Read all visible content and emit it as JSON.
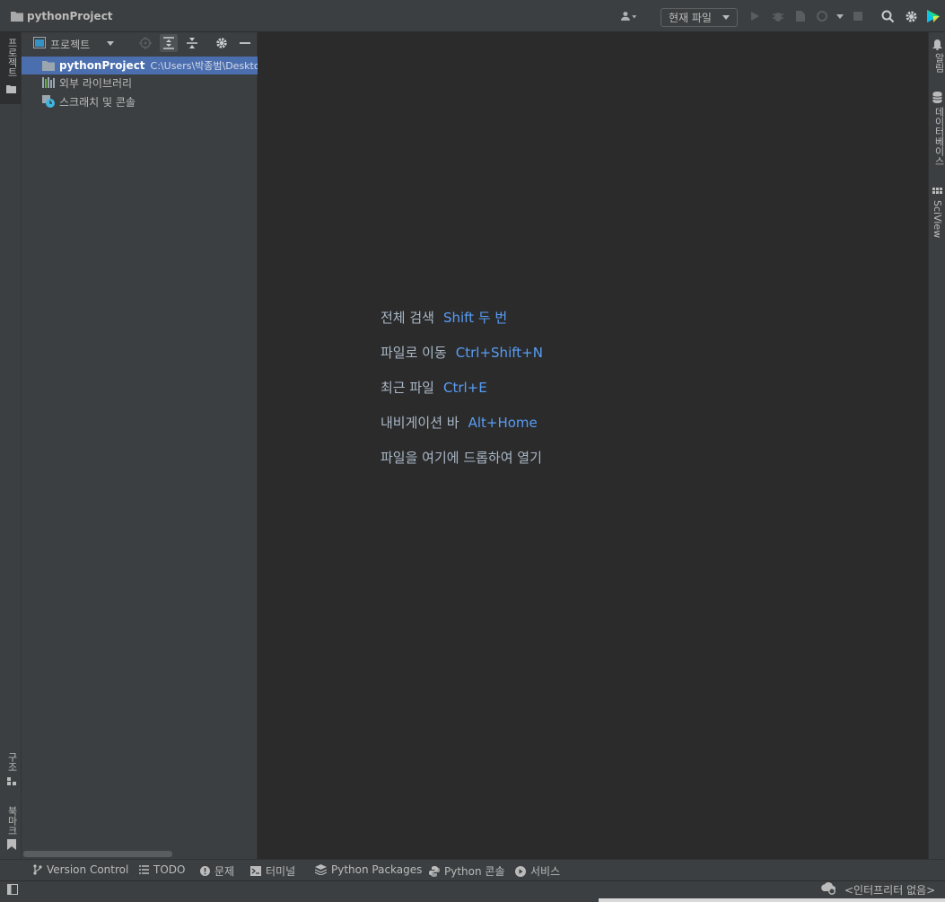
{
  "app": {
    "title": "pythonProject"
  },
  "toolbar": {
    "run_config": "현재 파일"
  },
  "left_stripe": {
    "project": "프로젝트",
    "structure": "구조",
    "bookmarks": "북마크"
  },
  "right_stripe": {
    "notifications": "알림",
    "database": "데이터베이스",
    "sciview": "SciView"
  },
  "project_panel": {
    "title": "프로젝트",
    "tree": [
      {
        "label": "pythonProject",
        "path": "C:\\Users\\박종범\\Deskto"
      },
      {
        "label": "외부 라이브러리"
      },
      {
        "label": "스크래치 및 콘솔"
      }
    ]
  },
  "editor": {
    "hints": [
      {
        "text": "전체 검색",
        "key": "Shift 두 번"
      },
      {
        "text": "파일로 이동",
        "key": "Ctrl+Shift+N"
      },
      {
        "text": "최근 파일",
        "key": "Ctrl+E"
      },
      {
        "text": "내비게이션 바",
        "key": "Alt+Home"
      },
      {
        "text": "파일을 여기에 드롭하여 열기",
        "key": ""
      }
    ]
  },
  "bottom_tabs": [
    {
      "label": "Version Control",
      "icon": "branch-icon"
    },
    {
      "label": "TODO",
      "icon": "list-icon"
    },
    {
      "label": "문제",
      "icon": "problems-icon"
    },
    {
      "label": "터미널",
      "icon": "terminal-icon"
    },
    {
      "label": "Python Packages",
      "icon": "layers-icon"
    },
    {
      "label": "Python 콘솔",
      "icon": "python-icon"
    },
    {
      "label": "서비스",
      "icon": "play-circle-icon"
    }
  ],
  "status": {
    "interpreter": "<인터프리터 없음>"
  },
  "colors": {
    "selection": "#4b6eaf",
    "editor_bg": "#2b2b2b",
    "panel_bg": "#3c3f41",
    "shortcut": "#589df6"
  }
}
